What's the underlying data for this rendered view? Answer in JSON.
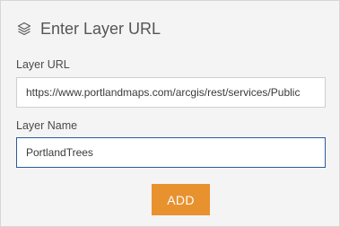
{
  "header": {
    "icon": "layers-icon",
    "title": "Enter Layer URL"
  },
  "form": {
    "layer_url": {
      "label": "Layer URL",
      "value": "https://www.portlandmaps.com/arcgis/rest/services/Public"
    },
    "layer_name": {
      "label": "Layer Name",
      "value": "PortlandTrees"
    },
    "add_button_label": "ADD"
  },
  "colors": {
    "accent": "#e8912f",
    "focus_border": "#2b5a9e",
    "panel_background": "#f4f4f4"
  }
}
